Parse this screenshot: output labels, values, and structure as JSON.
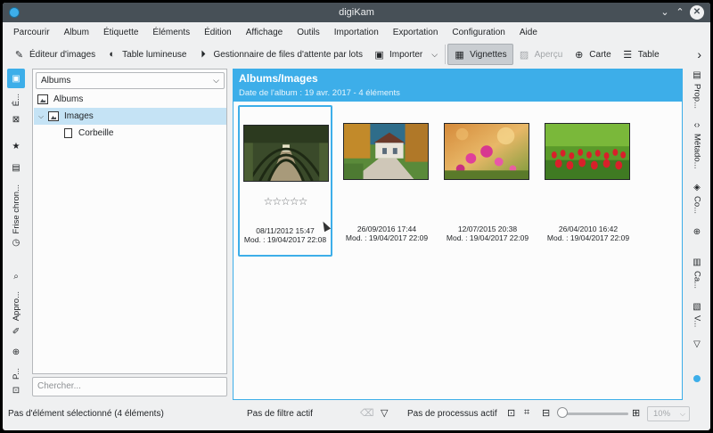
{
  "window": {
    "title": "digiKam"
  },
  "menu": [
    "Parcourir",
    "Album",
    "Étiquette",
    "Éléments",
    "Édition",
    "Affichage",
    "Outils",
    "Importation",
    "Exportation",
    "Configuration",
    "Aide"
  ],
  "toolbar": {
    "image_editor": "Éditeur d'images",
    "light_table": "Table lumineuse",
    "batch_queue": "Gestionnaire de files d'attente par lots",
    "import": "Importer",
    "thumbnails": "Vignettes",
    "preview": "Aperçu",
    "map": "Carte",
    "table": "Table"
  },
  "left_sidebar": {
    "tabs": [
      "É...",
      "Frise chron...",
      "Appro...",
      "P..."
    ]
  },
  "album_panel": {
    "selector": "Albums",
    "tree": [
      {
        "label": "Albums",
        "level": 0
      },
      {
        "label": "Images",
        "level": 1,
        "selected": true
      },
      {
        "label": "Corbeille",
        "level": 2
      }
    ],
    "search_placeholder": "Chercher..."
  },
  "main": {
    "title": "Albums/Images",
    "subtitle": "Date de l'album : 19 avr. 2017 - 4 éléments",
    "items": [
      {
        "date": "08/11/2012 15:47",
        "modified": "Mod. : 19/04/2017 22:08",
        "stars": "☆☆☆☆☆",
        "image": "tree-tunnel",
        "selected": true
      },
      {
        "date": "26/09/2016 17:44",
        "modified": "Mod. : 19/04/2017 22:09",
        "image": "cottage"
      },
      {
        "date": "12/07/2015 20:38",
        "modified": "Mod. : 19/04/2017 22:09",
        "image": "pink-flowers"
      },
      {
        "date": "26/04/2010 16:42",
        "modified": "Mod. : 19/04/2017 22:09",
        "image": "tulips"
      }
    ]
  },
  "right_sidebar": {
    "tabs": [
      "Prop...",
      "Métado...",
      "Co...",
      "Ca...",
      "V..."
    ]
  },
  "status": {
    "selection": "Pas d'élément sélectionné (4 éléments)",
    "filter": "Pas de filtre actif",
    "process": "Pas de processus actif",
    "zoom_level": "10%",
    "zoom_fraction": 0.0
  },
  "colors": {
    "accent": "#3daee9",
    "titlebar": "#475057",
    "window_bg": "#eff0f1"
  }
}
